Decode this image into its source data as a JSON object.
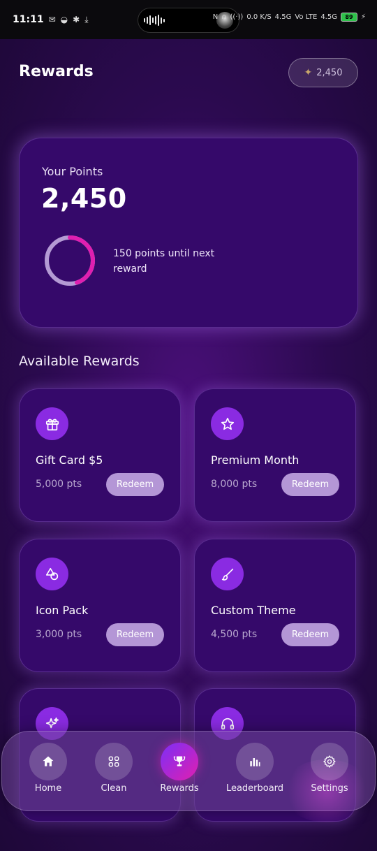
{
  "status_bar": {
    "time": "11:11",
    "battery": "89",
    "network_1": "4.5G",
    "network_2": "4.5G",
    "speed": "0.0 K/S",
    "volte": "Vo LTE"
  },
  "header": {
    "title": "Rewards",
    "points_chip": "2,450"
  },
  "points_card": {
    "label": "Your Points",
    "value": "2,450",
    "hint": "150 points until next reward",
    "progress_fraction": 0.45
  },
  "section": {
    "title": "Available Rewards"
  },
  "rewards": [
    {
      "name": "Gift Card $5",
      "points": "5,000 pts",
      "button": "Redeem",
      "icon": "gift-icon"
    },
    {
      "name": "Premium Month",
      "points": "8,000 pts",
      "button": "Redeem",
      "icon": "star-icon"
    },
    {
      "name": "Icon Pack",
      "points": "3,000 pts",
      "button": "Redeem",
      "icon": "shapes-icon"
    },
    {
      "name": "Custom Theme",
      "points": "4,500 pts",
      "button": "Redeem",
      "icon": "brush-icon"
    },
    {
      "name": "",
      "points": "",
      "button": "",
      "icon": "sparkles-icon"
    },
    {
      "name": "",
      "points": "",
      "button": "",
      "icon": "headphones-icon"
    }
  ],
  "nav": [
    {
      "label": "Home",
      "icon": "home-icon",
      "active": false
    },
    {
      "label": "Clean",
      "icon": "grid-icon",
      "active": false
    },
    {
      "label": "Rewards",
      "icon": "trophy-icon",
      "active": true
    },
    {
      "label": "Leaderboard",
      "icon": "bar-chart-icon",
      "active": false
    },
    {
      "label": "Settings",
      "icon": "gear-icon",
      "active": false
    }
  ],
  "colors": {
    "accent_purple": "#8a2be2",
    "accent_pink": "#e01fb0",
    "card_bg": "#35096a",
    "redeem_button": "#b496d6"
  }
}
